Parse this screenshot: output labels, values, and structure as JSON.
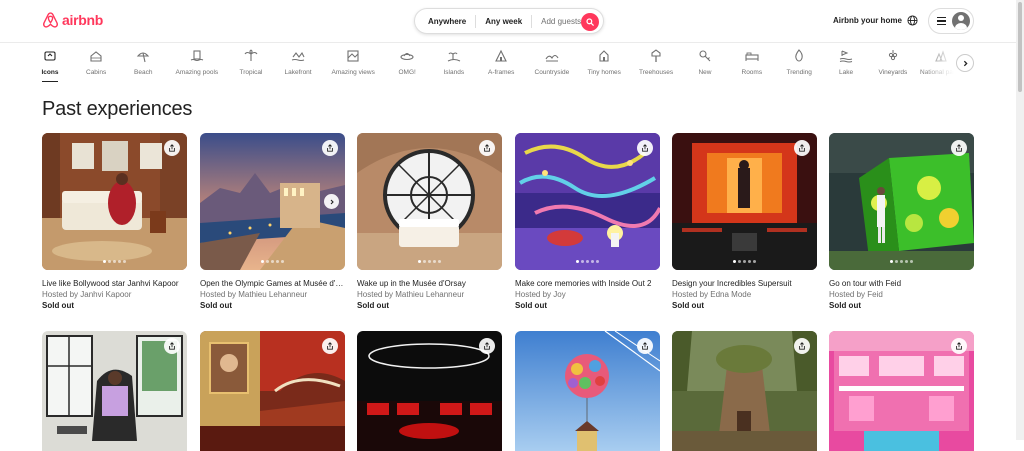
{
  "brand": {
    "name": "airbnb",
    "color": "#ff385c",
    "icon": "airbnb-logo-icon"
  },
  "search": {
    "where": "Anywhere",
    "when": "Any week",
    "who": "Add guests",
    "icon": "search-icon"
  },
  "header": {
    "host_link": "Airbnb your home",
    "globe_icon": "globe-icon",
    "menu_icon": "hamburger-icon",
    "avatar_icon": "user-avatar-icon"
  },
  "categories": [
    {
      "label": "Icons",
      "icon": "icons-icon",
      "active": true
    },
    {
      "label": "Cabins",
      "icon": "cabin-icon"
    },
    {
      "label": "Beach",
      "icon": "beach-umbrella-icon"
    },
    {
      "label": "Amazing pools",
      "icon": "pool-icon"
    },
    {
      "label": "Tropical",
      "icon": "palm-tree-icon"
    },
    {
      "label": "Lakefront",
      "icon": "lakefront-icon"
    },
    {
      "label": "Amazing views",
      "icon": "view-icon"
    },
    {
      "label": "OMG!",
      "icon": "ufo-icon"
    },
    {
      "label": "Islands",
      "icon": "island-icon"
    },
    {
      "label": "A-frames",
      "icon": "a-frame-icon"
    },
    {
      "label": "Countryside",
      "icon": "countryside-icon"
    },
    {
      "label": "Tiny homes",
      "icon": "tiny-home-icon"
    },
    {
      "label": "Treehouses",
      "icon": "treehouse-icon"
    },
    {
      "label": "New",
      "icon": "new-key-icon"
    },
    {
      "label": "Rooms",
      "icon": "bed-icon"
    },
    {
      "label": "Trending",
      "icon": "flame-icon"
    },
    {
      "label": "Lake",
      "icon": "lake-icon"
    },
    {
      "label": "Vineyards",
      "icon": "vineyard-icon"
    },
    {
      "label": "National parks",
      "icon": "national-park-icon"
    }
  ],
  "page": {
    "title": "Past experiences"
  },
  "experiences": [
    {
      "title": "Live like Bollywood star Janhvi Kapoor",
      "host": "Hosted by Janhvi Kapoor",
      "status": "Sold out"
    },
    {
      "title": "Open the Olympic Games at Musée d'Orsay",
      "host": "Hosted by Mathieu Lehanneur",
      "status": "Sold out"
    },
    {
      "title": "Wake up in the Musée d'Orsay",
      "host": "Hosted by Mathieu Lehanneur",
      "status": "Sold out"
    },
    {
      "title": "Make core memories with Inside Out 2",
      "host": "Hosted by Joy",
      "status": "Sold out"
    },
    {
      "title": "Design your Incredibles Supersuit",
      "host": "Hosted by Edna Mode",
      "status": "Sold out"
    },
    {
      "title": "Go on tour with Feid",
      "host": "Hosted by Feid",
      "status": "Sold out"
    }
  ],
  "icons": {
    "share": "share-icon",
    "next": "chevron-right-icon"
  }
}
